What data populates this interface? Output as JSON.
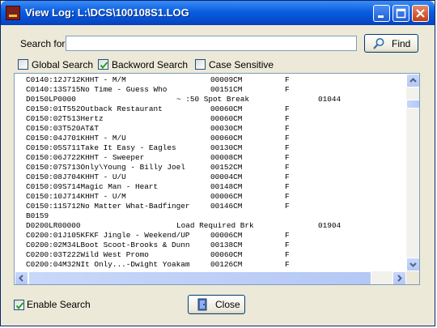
{
  "window": {
    "title": "View Log: L:\\DCS\\100108S1.LOG"
  },
  "search": {
    "label": "Search for:",
    "value": "",
    "find_label": "Find"
  },
  "options": {
    "global_search": {
      "label": "Global Search",
      "checked": false
    },
    "backword_search": {
      "label": "Backword Search",
      "checked": true
    },
    "case_sensitive": {
      "label": "Case Sensitive",
      "checked": false
    }
  },
  "log": {
    "rows": [
      {
        "line": "C0140:12J712KHHT - M/M",
        "len": "00009CM",
        "flag": "F",
        "extra": ""
      },
      {
        "line": "C0140:13S715No Time - Guess Who",
        "len": "00151CM",
        "flag": "F",
        "extra": ""
      },
      {
        "line": "D0150LP0000",
        "len": "~ :50 Spot Break",
        "flag": "",
        "extra": "01044"
      },
      {
        "line": "C0150:01T552Outback Restaurant",
        "len": "00060CM",
        "flag": "F",
        "extra": ""
      },
      {
        "line": "C0150:02T513Hertz",
        "len": "00060CM",
        "flag": "F",
        "extra": ""
      },
      {
        "line": "C0150:03T520AT&T",
        "len": "00030CM",
        "flag": "F",
        "extra": ""
      },
      {
        "line": "C0150:04J701KHHT - M/U",
        "len": "00060CM",
        "flag": "F",
        "extra": ""
      },
      {
        "line": "C0150:05S711Take It Easy - Eagles",
        "len": "00130CM",
        "flag": "F",
        "extra": ""
      },
      {
        "line": "C0150:06J722KHHT - Sweeper",
        "len": "00008CM",
        "flag": "F",
        "extra": ""
      },
      {
        "line": "C0150:07S713Only\\Young - Billy Joel",
        "len": "00152CM",
        "flag": "F",
        "extra": ""
      },
      {
        "line": "C0150:08J704KHHT - U/U",
        "len": "00004CM",
        "flag": "F",
        "extra": ""
      },
      {
        "line": "C0150:09S714Magic Man - Heart",
        "len": "00148CM",
        "flag": "F",
        "extra": ""
      },
      {
        "line": "C0150:10J714KHHT - U/M",
        "len": "00006CM",
        "flag": "F",
        "extra": ""
      },
      {
        "line": "C0150:11S712No Matter What-Badfinger",
        "len": "00146CM",
        "flag": "F",
        "extra": ""
      },
      {
        "line": "B0159",
        "len": "",
        "flag": "",
        "extra": ""
      },
      {
        "line": "D0200LR00000",
        "len": "Load Required Brk",
        "flag": "",
        "extra": "01904"
      },
      {
        "line": "C0200:01J105KFKF Jingle - Weekend/UP",
        "len": "00006CM",
        "flag": "F",
        "extra": ""
      },
      {
        "line": "C0200:02M34LBoot Scoot-Brooks & Dunn",
        "len": "00138CM",
        "flag": "F",
        "extra": ""
      },
      {
        "line": "C0200:03T222Wild West Promo",
        "len": "00060CM",
        "flag": "F",
        "extra": ""
      },
      {
        "line": "C0200:04M32NIt Only...-Dwight Yoakam",
        "len": "00126CM",
        "flag": "F",
        "extra": ""
      }
    ]
  },
  "footer": {
    "enable_search": {
      "label": "Enable Search",
      "checked": true
    },
    "close_label": "Close"
  },
  "colors": {
    "title_bar": "#0a5ee0",
    "window_bg": "#ece9d8",
    "border": "#7f9db9"
  }
}
